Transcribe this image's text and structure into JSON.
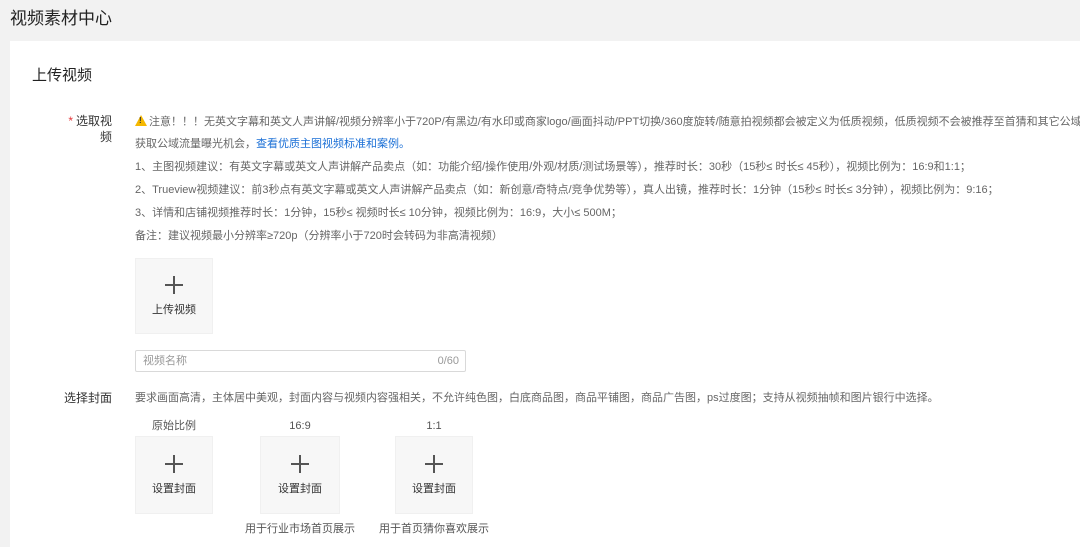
{
  "page_title": "视频素材中心",
  "section_title": "上传视频",
  "select_video": {
    "required_mark": "*",
    "label": "选取视频",
    "notes": {
      "warning": "注意！！！无英文字幕和英文人声讲解/视频分辨率小于720P/有黑边/有水印或商家logo/画面抖动/PPT切换/360度旋转/随意拍视频都会被定义为低质视频，低质视频不会被推荐至首猜和其它公域场景，仅优质主图视频被推荐至首猜",
      "line2_prefix": "获取公域流量曝光机会，",
      "line2_link": "查看优质主图视频标准和案例。",
      "line3": "1、主图视频建议：有英文字幕或英文人声讲解产品卖点（如：功能介绍/操作使用/外观/材质/测试场景等），推荐时长：30秒（15秒≤ 时长≤ 45秒），视频比例为：16:9和1:1；",
      "line4": "2、Trueview视频建议：前3秒点有英文字幕或英文人声讲解产品卖点（如：新创意/奇特点/竞争优势等），真人出镜，推荐时长：1分钟（15秒≤ 时长≤ 3分钟），视频比例为：9:16；",
      "line5": "3、详情和店铺视频推荐时长：1分钟，15秒≤ 视频时长≤ 10分钟，视频比例为：16:9，大小≤ 500M；",
      "line6": "备注：建议视频最小分辨率≥720p（分辨率小于720时会转码为非高清视频）"
    },
    "upload_label": "上传视频",
    "name_input": {
      "placeholder": "视频名称",
      "value": "",
      "counter": "0/60"
    }
  },
  "select_cover": {
    "label": "选择封面",
    "description": "要求画面高清，主体居中美观，封面内容与视频内容强相关，不允许纯色图，白底商品图，商品平铺图，商品广告图，ps过度图；支持从视频抽帧和图片银行中选择。",
    "slots": [
      {
        "ratio": "原始比例",
        "button": "设置封面",
        "caption": ""
      },
      {
        "ratio": "16:9",
        "button": "设置封面",
        "caption": "用于行业市场首页展示"
      },
      {
        "ratio": "1:1",
        "button": "设置封面",
        "caption": "用于首页猜你喜欢展示"
      }
    ]
  },
  "icons": {
    "warning": "warning-triangle-icon",
    "plus": "plus-icon"
  },
  "colors": {
    "link": "#1a6fd6",
    "required": "#e4393c",
    "warning": "#f5b800"
  }
}
